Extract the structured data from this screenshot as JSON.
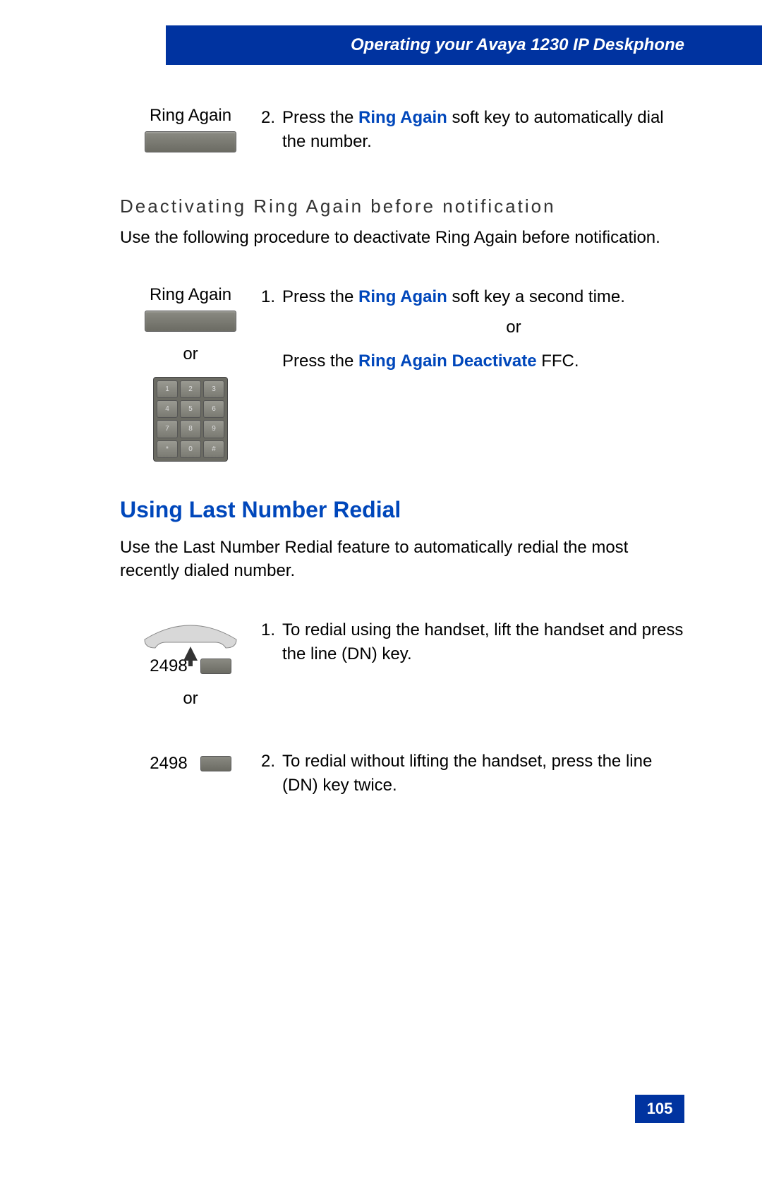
{
  "header": {
    "title": "Operating your Avaya 1230 IP Deskphone"
  },
  "step1": {
    "label": "Ring Again",
    "num": "2.",
    "text_before": "Press the ",
    "blue": "Ring Again",
    "text_after": " soft key to automatically dial the number."
  },
  "section1": {
    "subtitle": "Deactivating Ring Again before notification",
    "intro": "Use the following procedure to deactivate Ring Again before notification."
  },
  "step2": {
    "label": "Ring Again",
    "or": "or",
    "num": "1.",
    "text1_before": "Press the ",
    "text1_blue": "Ring Again",
    "text1_after": " soft key a second time.",
    "or_right": "or",
    "text2_before": "Press the ",
    "text2_blue": "Ring Again Deactivate",
    "text2_after": " FFC."
  },
  "section2": {
    "title": "Using Last Number Redial",
    "intro": "Use the Last Number Redial feature to automatically redial the most recently dialed number."
  },
  "step3": {
    "dn": "2498",
    "or": "or",
    "num": "1.",
    "text": "To redial using the handset, lift the handset and press the line (DN) key."
  },
  "step4": {
    "dn": "2498",
    "num": "2.",
    "text": "To redial without lifting the handset, press the line (DN) key twice."
  },
  "page_number": "105"
}
